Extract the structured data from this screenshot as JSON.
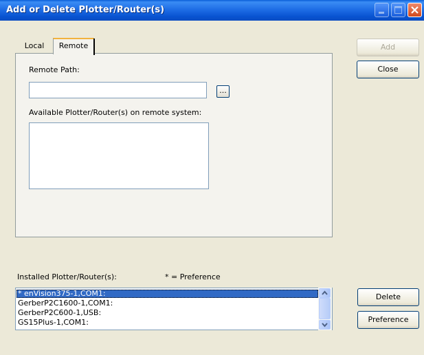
{
  "window": {
    "title": "Add or Delete Plotter/Router(s)"
  },
  "tabs": [
    {
      "label": "Local",
      "active": false
    },
    {
      "label": "Remote",
      "active": true
    }
  ],
  "remote": {
    "path_label": "Remote Path:",
    "path_value": "",
    "browse_label": "...",
    "available_label": "Available Plotter/Router(s) on remote system:",
    "available_items": []
  },
  "buttons": {
    "add": "Add",
    "close": "Close",
    "delete": "Delete",
    "preference": "Preference"
  },
  "installed": {
    "label": "Installed Plotter/Router(s):",
    "preference_note": "* = Preference",
    "items": [
      {
        "text": "* enVision375-1,COM1:",
        "selected": true
      },
      {
        "text": "GerberP2C1600-1,COM1:",
        "selected": false
      },
      {
        "text": "GerberP2C600-1,USB:",
        "selected": false
      },
      {
        "text": "GS15Plus-1,COM1:",
        "selected": false
      }
    ]
  },
  "colors": {
    "titlebar": "#0853d1",
    "selection": "#316ac5",
    "dialog_bg": "#ece9d8",
    "close_button": "#d24a1e"
  },
  "icons": [
    "minimize-icon",
    "maximize-icon",
    "close-icon",
    "scroll-up-arrow-icon",
    "scroll-down-arrow-icon"
  ]
}
